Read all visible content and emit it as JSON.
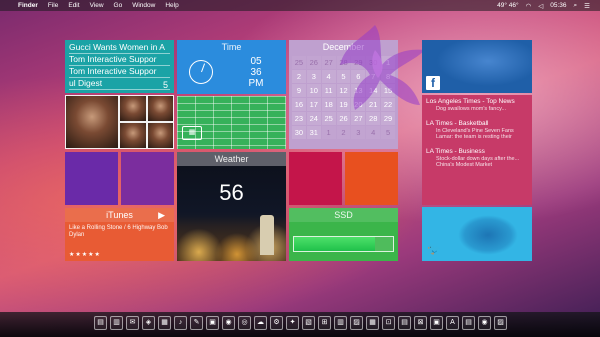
{
  "menubar": {
    "apple": "",
    "app": "Finder",
    "items": [
      "File",
      "Edit",
      "View",
      "Go",
      "Window",
      "Help"
    ],
    "temp": "49° 46°",
    "clock": "05:36"
  },
  "news": {
    "lines": [
      "Gucci Wants Women in A",
      "Tom Interactive Suppor",
      "Tom Interactive Suppor",
      "ul Digest"
    ],
    "count": "5"
  },
  "time": {
    "title": "Time",
    "hour": "05",
    "minute": "36",
    "ampm": "PM"
  },
  "calendar": {
    "title": "December",
    "days": [
      "25",
      "26",
      "27",
      "28",
      "29",
      "30",
      "1",
      "2",
      "3",
      "4",
      "5",
      "6",
      "7",
      "8",
      "9",
      "10",
      "11",
      "12",
      "13",
      "14",
      "15",
      "16",
      "17",
      "18",
      "19",
      "20",
      "21",
      "22",
      "23",
      "24",
      "25",
      "26",
      "27",
      "28",
      "29",
      "30",
      "31",
      "1",
      "2",
      "3",
      "4",
      "5"
    ]
  },
  "headlines": {
    "groups": [
      {
        "title": "Los Angeles Times - Top News",
        "items": [
          "Dog swallows mom's fancy..."
        ]
      },
      {
        "title": "LA Times - Basketball",
        "items": [
          "In Cleveland's Pine Seven Fans",
          "Lamar: the team is resting their"
        ]
      },
      {
        "title": "LA Times - Business",
        "items": [
          "Stock-dollar down days after the...",
          "China's Modest Market"
        ]
      }
    ]
  },
  "weather": {
    "title": "Weather",
    "temp": "56"
  },
  "itunes": {
    "title": "iTunes",
    "play": "▶",
    "track": "Like a Rolling Stone / 6 Highway Bob Dylan",
    "rating": "★★★★★"
  },
  "ssd": {
    "title": "SSD",
    "used_fraction": 0.82
  },
  "icons": {
    "facebook": "f",
    "twitter": "🐦"
  },
  "dock": {
    "items": [
      "▤",
      "▥",
      "✉",
      "◈",
      "▦",
      "♪",
      "✎",
      "▣",
      "◉",
      "◎",
      "☁",
      "⚙",
      "✦",
      "▧",
      "⊞",
      "▥",
      "▨",
      "▦",
      "⊡",
      "▤",
      "⊠",
      "▣",
      "A",
      "▤",
      "◉",
      "▨"
    ]
  },
  "colors": {
    "news": "#1ba3a6",
    "time": "#2b8cdd",
    "sheet": "#36b15a",
    "calendar": "#bfa0cf",
    "facebook": "#1f5fa8",
    "headlines": "#c73a68",
    "twitter": "#33b5e5",
    "purple": "#6a2aa8",
    "red": "#c4154a",
    "orange": "#e8501f",
    "itunes": "#e85b34",
    "ssd": "#3bb54a"
  }
}
